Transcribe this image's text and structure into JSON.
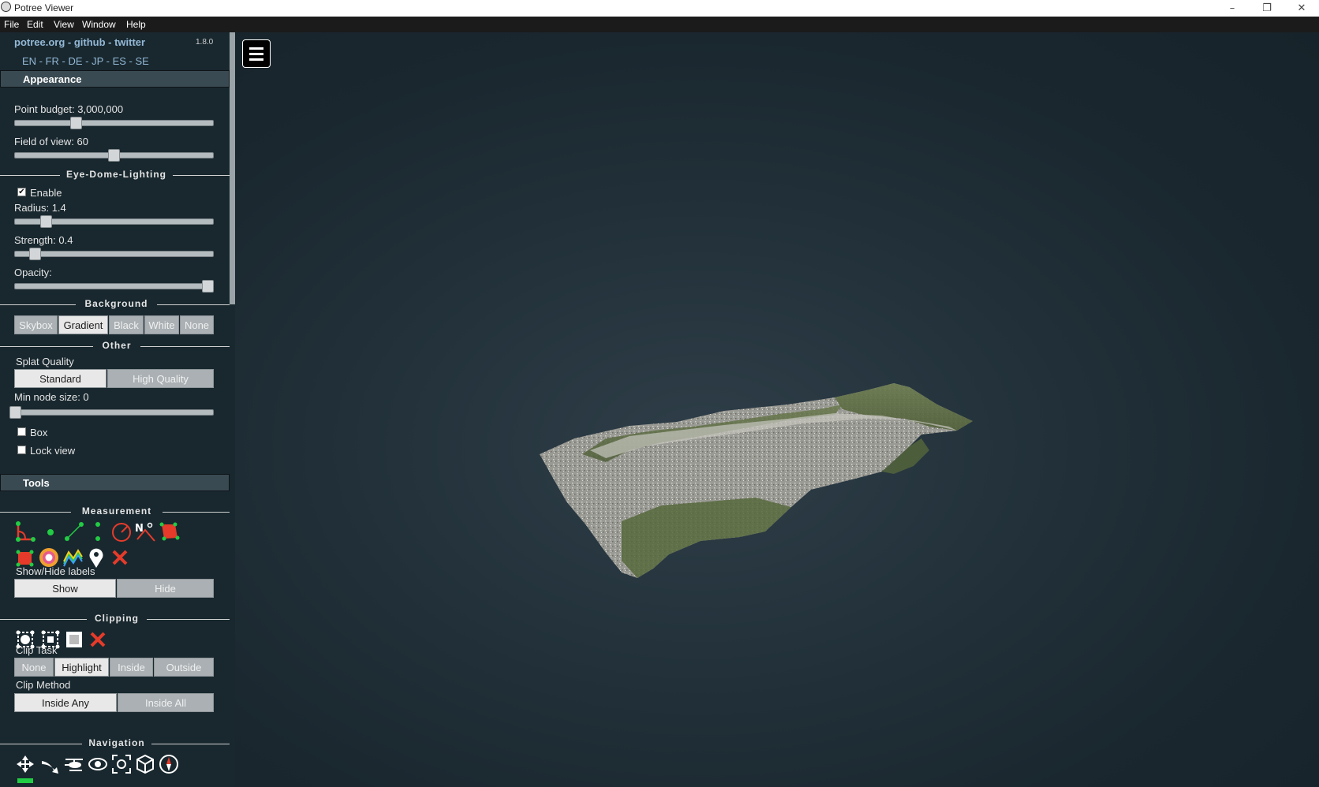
{
  "window": {
    "title": "Potree Viewer",
    "controls": [
      "–",
      "❐",
      "✕"
    ]
  },
  "menubar": [
    "File",
    "Edit",
    "View",
    "Window",
    "Help"
  ],
  "sidebar": {
    "links": "potree.org - github - twitter",
    "version": "1.8.0",
    "languages": "EN - FR - DE - JP - ES - SE",
    "appearance": {
      "header": "Appearance",
      "point_budget_label": "Point budget: 3,000,000",
      "point_budget_level": 0.3,
      "fov_label": "Field of view: 60",
      "fov_level": 0.5,
      "edl_heading": "Eye-Dome-Lighting",
      "edl_enable_label": "Enable",
      "edl_enabled": true,
      "radius_label": "Radius: 1.4",
      "radius_level": 0.14,
      "strength_label": "Strength: 0.4",
      "strength_level": 0.08,
      "opacity_label": "Opacity:",
      "opacity_level": 1.0,
      "background_heading": "Background",
      "background_options": [
        "Skybox",
        "Gradient",
        "Black",
        "White",
        "None"
      ],
      "background_selected": "Gradient",
      "other_heading": "Other",
      "splat_quality_label": "Splat Quality",
      "splat_options": [
        "Standard",
        "High Quality"
      ],
      "splat_selected": "Standard",
      "min_node_label": "Min node size: 0",
      "min_node_level": 0.0,
      "box_label": "Box",
      "lock_view_label": "Lock view"
    },
    "tools": {
      "header": "Tools",
      "measurement_heading": "Measurement",
      "measurement_icons": [
        "angle-icon",
        "point-icon",
        "distance-icon",
        "height-icon",
        "circle-icon",
        "azimuth-icon",
        "area-icon",
        "volume-icon",
        "sphere-volume-icon",
        "profile-icon",
        "annotation-icon",
        "remove-measurements-icon"
      ],
      "azimuth_text": "N",
      "labels_heading": "Show/Hide labels",
      "labels_options": [
        "Show",
        "Hide"
      ],
      "labels_selected": "Show",
      "clipping_heading": "Clipping",
      "clip_icons": [
        "clip-volume-icon",
        "clip-polygon-icon",
        "clip-screen-icon",
        "remove-clip-icon"
      ],
      "clip_task_label": "Clip Task",
      "clip_task_options": [
        "None",
        "Highlight",
        "Inside",
        "Outside"
      ],
      "clip_task_selected": "Highlight",
      "clip_method_label": "Clip Method",
      "clip_method_options": [
        "Inside Any",
        "Inside All"
      ],
      "clip_method_selected": "Inside Any",
      "navigation_heading": "Navigation",
      "nav_icons": [
        "earth-controls-icon",
        "fly-controls-icon",
        "helicopter-controls-icon",
        "orbit-controls-icon",
        "focus-icon",
        "perspective-camera-icon",
        "compass-icon"
      ]
    }
  },
  "colors": {
    "panel_bg": "#19282f",
    "link": "#93b8d6",
    "measure_red": "#e63b2a",
    "measure_green": "#22cc44"
  }
}
